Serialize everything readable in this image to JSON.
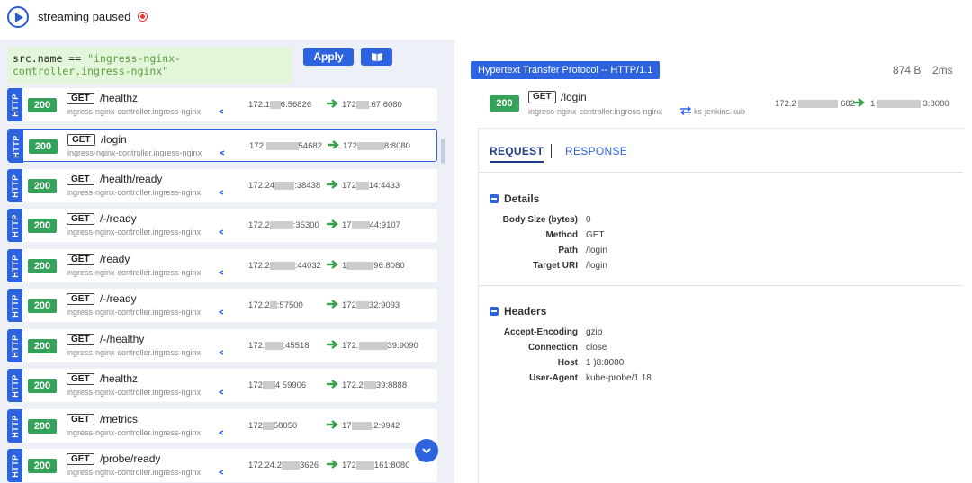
{
  "topbar": {
    "status_text": "streaming paused"
  },
  "filter": {
    "prefix": "src.name ==",
    "value": "\"ingress-nginx-controller.ingress-nginx\"",
    "apply_label": "Apply"
  },
  "entries": [
    {
      "protocol": "HTTP",
      "status": "200",
      "method": "GET",
      "path": "/healthz",
      "service": "ingress-nginx-controller.ingress-nginx",
      "src_a": "172.1",
      "src_b": "6:56826",
      "dst_a": "172",
      "dst_b": ".67:6080"
    },
    {
      "protocol": "HTTP",
      "status": "200",
      "method": "GET",
      "path": "/login",
      "service": "ingress-nginx-controller.ingress-nginx",
      "src_a": "172.",
      "src_b": "54682",
      "dst_a": "172",
      "dst_b": "8:8080"
    },
    {
      "protocol": "HTTP",
      "status": "200",
      "method": "GET",
      "path": "/health/ready",
      "service": "ingress-nginx-controller.ingress-nginx",
      "src_a": "172.24",
      "src_b": ":38438",
      "dst_a": "172",
      "dst_b": "14:4433"
    },
    {
      "protocol": "HTTP",
      "status": "200",
      "method": "GET",
      "path": "/-/ready",
      "service": "ingress-nginx-controller.ingress-nginx",
      "src_a": "172.2",
      "src_b": ":35300",
      "dst_a": "17",
      "dst_b": "44:9107"
    },
    {
      "protocol": "HTTP",
      "status": "200",
      "method": "GET",
      "path": "/ready",
      "service": "ingress-nginx-controller.ingress-nginx",
      "src_a": "172.2",
      "src_b": ":44032",
      "dst_a": "1",
      "dst_b": "96:8080"
    },
    {
      "protocol": "HTTP",
      "status": "200",
      "method": "GET",
      "path": "/-/ready",
      "service": "ingress-nginx-controller.ingress-nginx",
      "src_a": "172.2",
      "src_b": ":57500",
      "dst_a": "172",
      "dst_b": "32:9093"
    },
    {
      "protocol": "HTTP",
      "status": "200",
      "method": "GET",
      "path": "/-/healthy",
      "service": "ingress-nginx-controller.ingress-nginx",
      "src_a": "172.",
      "src_b": ":45518",
      "dst_a": "172.",
      "dst_b": "39:9090"
    },
    {
      "protocol": "HTTP",
      "status": "200",
      "method": "GET",
      "path": "/healthz",
      "service": "ingress-nginx-controller.ingress-nginx",
      "src_a": "172",
      "src_b": "4  59906",
      "dst_a": "172.2",
      "dst_b": "39:8888"
    },
    {
      "protocol": "HTTP",
      "status": "200",
      "method": "GET",
      "path": "/metrics",
      "service": "ingress-nginx-controller.ingress-nginx",
      "src_a": "172",
      "src_b": "58050",
      "dst_a": "17",
      "dst_b": ".2:9942"
    },
    {
      "protocol": "HTTP",
      "status": "200",
      "method": "GET",
      "path": "/probe/ready",
      "service": "ingress-nginx-controller.ingress-nginx",
      "src_a": "172.24.2",
      "src_b": "3626",
      "dst_a": "172",
      "dst_b": "161:8080"
    }
  ],
  "detail": {
    "protocol_label": "Hypertext Transfer Protocol -- HTTP/1.1",
    "size": "874 B",
    "elapsed": "2ms",
    "status": "200",
    "method": "GET",
    "path": "/login",
    "service": "ingress-nginx-controller.ingress-nginx",
    "dst_service": "ks-jenkins.kub",
    "src_a": "172.2",
    "src_b": "682",
    "dst_a": "1",
    "dst_b": "3:8080",
    "tabs": {
      "request": "REQUEST",
      "response": "RESPONSE"
    },
    "details_section": {
      "title": "Details",
      "rows": [
        {
          "key": "Body Size (bytes)",
          "value": "0"
        },
        {
          "key": "Method",
          "value": "GET"
        },
        {
          "key": "Path",
          "value": "/login"
        },
        {
          "key": "Target URI",
          "value": "/login"
        }
      ]
    },
    "headers_section": {
      "title": "Headers",
      "rows": [
        {
          "key": "Accept-Encoding",
          "value": "gzip"
        },
        {
          "key": "Connection",
          "value": "close"
        },
        {
          "key": "Host",
          "value": "1                    )8:8080"
        },
        {
          "key": "User-Agent",
          "value": "kube-probe/1.18"
        }
      ]
    }
  },
  "colors": {
    "accent": "#2e63e0",
    "status_ok": "#33a35a",
    "filter_bg": "#e3f6da",
    "panel_bg": "#eef0f7"
  }
}
